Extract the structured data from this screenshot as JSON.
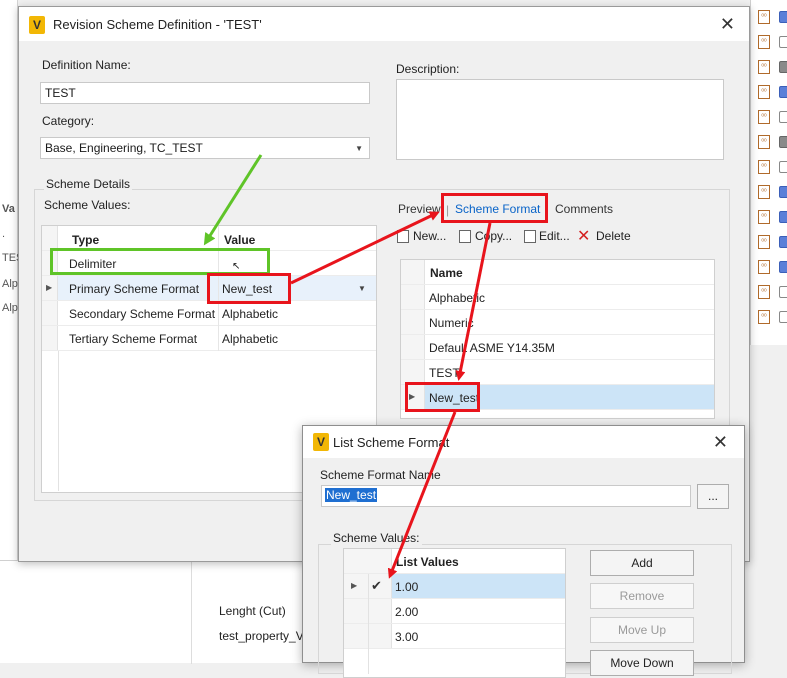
{
  "background": {
    "left_column": {
      "header": "Va",
      "cells": [
        ".",
        "TES",
        "Alp",
        "Alp"
      ]
    },
    "lower_panel": {
      "properties": [
        "Lenght (Cut)",
        "test_property_V("
      ]
    }
  },
  "main_dialog": {
    "title": "Revision Scheme Definition - 'TEST'",
    "definition_name_label": "Definition Name:",
    "definition_name_value": "TEST",
    "description_label": "Description:",
    "description_value": "",
    "category_label": "Category:",
    "category_value": "Base, Engineering, TC_TEST",
    "scheme_details_label": "Scheme Details",
    "scheme_values_label": "Scheme Values:",
    "grid": {
      "columns": [
        "Type",
        "Value"
      ],
      "rows": [
        {
          "type": "Delimiter",
          "value": ""
        },
        {
          "type": "Primary Scheme Format",
          "value": "New_test"
        },
        {
          "type": "Secondary Scheme Format",
          "value": "Alphabetic"
        },
        {
          "type": "Tertiary Scheme Format",
          "value": "Alphabetic"
        }
      ]
    },
    "tabs": [
      "Preview",
      "Scheme Format",
      "Comments"
    ],
    "active_tab": "Scheme Format",
    "toolbar": {
      "new": "New...",
      "copy": "Copy...",
      "edit": "Edit...",
      "delete": "Delete"
    },
    "format_list": {
      "column": "Name",
      "items": [
        "Alphabetic",
        "Numeric",
        "Default ASME Y14.35M",
        "TEST",
        "New_test"
      ],
      "selected": "New_test"
    }
  },
  "list_dialog": {
    "title": "List Scheme Format",
    "name_label": "Scheme Format Name",
    "name_value": "New_test",
    "browse_label": "...",
    "values_label": "Scheme Values:",
    "column": "List Values",
    "values": [
      "1.00",
      "2.00",
      "3.00"
    ],
    "buttons": {
      "add": "Add",
      "remove": "Remove",
      "move_up": "Move Up",
      "move_down": "Move Down"
    }
  },
  "colors": {
    "annotation_red": "#e8141c",
    "annotation_green": "#5fc428",
    "selection": "#cce4f7",
    "accent": "#0a64c8"
  }
}
